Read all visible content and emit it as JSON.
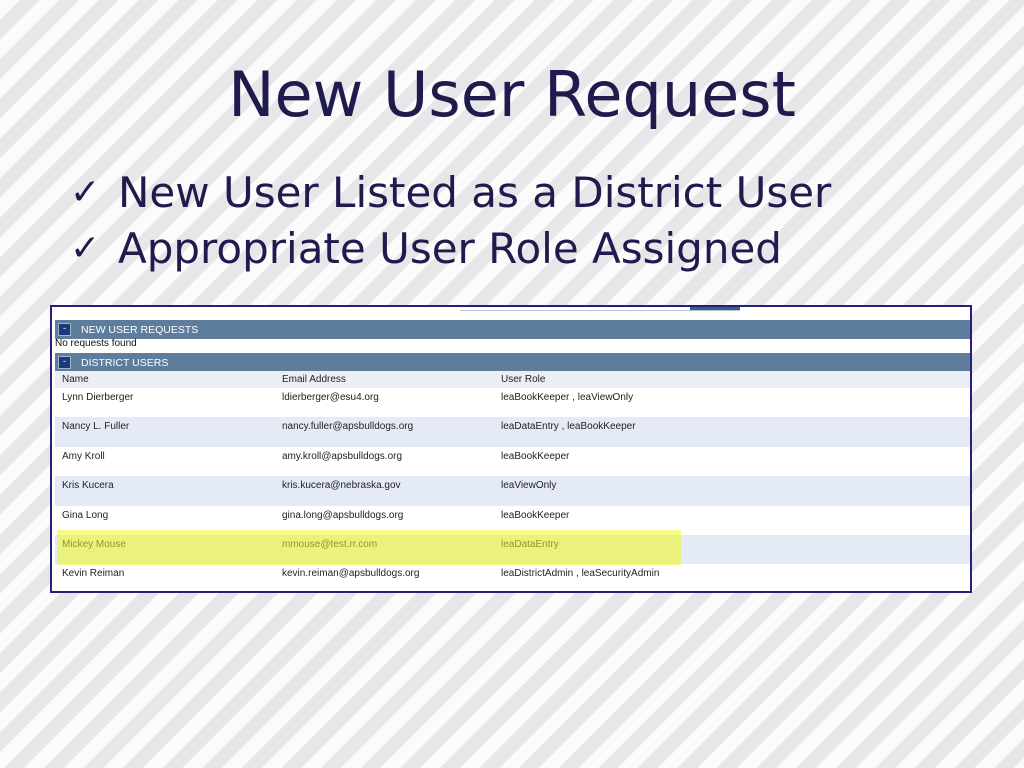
{
  "slide": {
    "title": "New User Request",
    "bullets": [
      {
        "check": "✓",
        "text": "New User Listed as a District User"
      },
      {
        "check": "✓",
        "text": "Appropriate User Role Assigned"
      }
    ]
  },
  "app": {
    "new_requests": {
      "toggle": "-",
      "title": "NEW USER REQUESTS",
      "empty_text": "No requests found"
    },
    "district_users": {
      "toggle": "-",
      "title": "DISTRICT USERS",
      "columns": [
        "Name",
        "Email Address",
        "User Role"
      ],
      "rows": [
        {
          "name": "Lynn Dierberger",
          "email": "ldierberger@esu4.org",
          "role": "leaBookKeeper , leaViewOnly"
        },
        {
          "name": "Nancy L. Fuller",
          "email": "nancy.fuller@apsbulldogs.org",
          "role": "leaDataEntry , leaBookKeeper"
        },
        {
          "name": "Amy Kroll",
          "email": "amy.kroll@apsbulldogs.org",
          "role": "leaBookKeeper"
        },
        {
          "name": "Kris Kucera",
          "email": "kris.kucera@nebraska.gov",
          "role": "leaViewOnly"
        },
        {
          "name": "Gina Long",
          "email": "gina.long@apsbulldogs.org",
          "role": "leaBookKeeper"
        },
        {
          "name": "Mickey Mouse",
          "email": "mmouse@test.rr.com",
          "role": "leaDataEntry"
        },
        {
          "name": "Kevin Reiman",
          "email": "kevin.reiman@apsbulldogs.org",
          "role": "leaDistrictAdmin , leaSecurityAdmin"
        }
      ],
      "highlighted_user": "Mickey Mouse"
    }
  },
  "colors": {
    "title": "#1f1b4d",
    "section_header": "#5e7d9d",
    "row_alt": "#e4ebf6",
    "frame_border": "#25207a",
    "highlight": "#f0f51e"
  }
}
